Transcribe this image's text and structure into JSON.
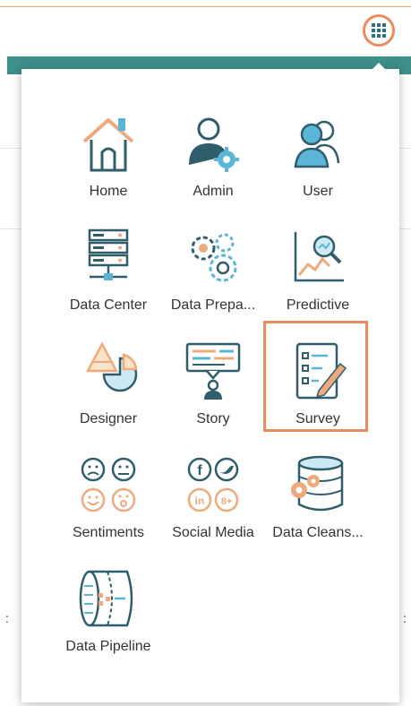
{
  "launcher": {
    "icon": "app-grid-icon",
    "accent": "#ea8a5e"
  },
  "colors": {
    "teal": "#3d8f88",
    "icon_dark": "#2f5d6a",
    "icon_orange": "#f0a97c",
    "icon_blue": "#5ab5d6",
    "highlight": "#ea8a5e"
  },
  "menu": {
    "items": [
      {
        "label": "Home",
        "icon": "home-icon"
      },
      {
        "label": "Admin",
        "icon": "admin-icon"
      },
      {
        "label": "User",
        "icon": "user-icon"
      },
      {
        "label": "Data Center",
        "icon": "data-center-icon"
      },
      {
        "label": "Data Prepa...",
        "icon": "data-preparation-icon"
      },
      {
        "label": "Predictive",
        "icon": "predictive-icon"
      },
      {
        "label": "Designer",
        "icon": "designer-icon"
      },
      {
        "label": "Story",
        "icon": "story-icon"
      },
      {
        "label": "Survey",
        "icon": "survey-icon",
        "selected": true
      },
      {
        "label": "Sentiments",
        "icon": "sentiments-icon"
      },
      {
        "label": "Social Media",
        "icon": "social-media-icon"
      },
      {
        "label": "Data Cleans...",
        "icon": "data-cleansing-icon"
      },
      {
        "label": "Data Pipeline",
        "icon": "data-pipeline-icon"
      }
    ]
  }
}
